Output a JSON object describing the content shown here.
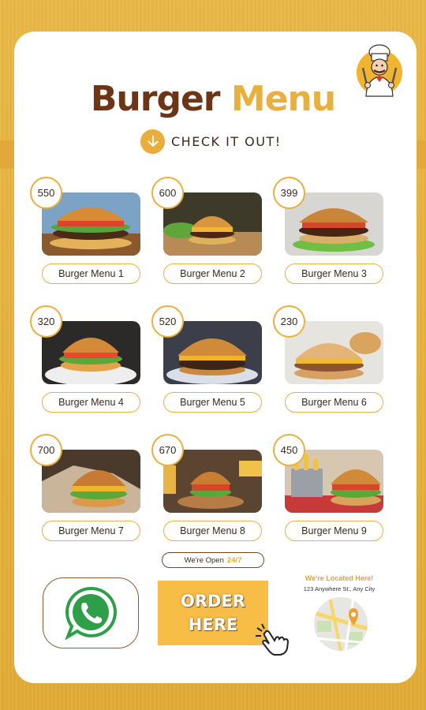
{
  "header": {
    "title_part1": "Burger",
    "title_part2": "Menu",
    "cta": "CHECK IT OUT!"
  },
  "menu": [
    {
      "price": "550",
      "name": "Burger Menu 1"
    },
    {
      "price": "600",
      "name": "Burger Menu 2"
    },
    {
      "price": "399",
      "name": "Burger Menu 3"
    },
    {
      "price": "320",
      "name": "Burger Menu 4"
    },
    {
      "price": "520",
      "name": "Burger Menu 5"
    },
    {
      "price": "230",
      "name": "Burger Menu 6"
    },
    {
      "price": "700",
      "name": "Burger Menu 7"
    },
    {
      "price": "670",
      "name": "Burger Menu 8"
    },
    {
      "price": "450",
      "name": "Burger Menu 9"
    }
  ],
  "hours": {
    "label": "We're Open",
    "value": "24/7"
  },
  "order": {
    "line1": "ORDER",
    "line2": "HERE"
  },
  "location": {
    "title": "We're Located Here!",
    "address": "123 Anywhere St., Any City"
  },
  "colors": {
    "brown": "#6e3416",
    "gold": "#e8b03c",
    "background": "#e8b23f"
  }
}
